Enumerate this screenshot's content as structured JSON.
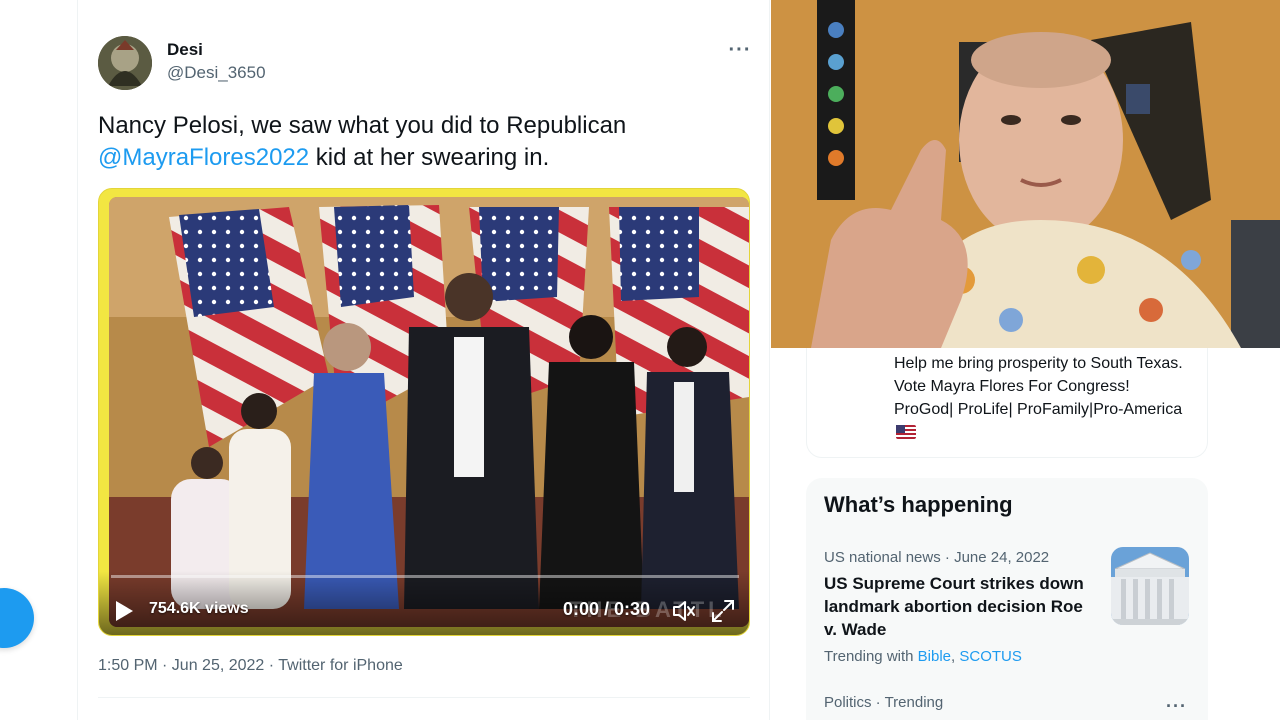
{
  "tweet": {
    "display_name": "Desi",
    "handle": "@Desi_3650",
    "text_before": "Nancy Pelosi, we saw what you did to Republican ",
    "mention": "@MayraFlores2022",
    "text_after": " kid at her swearing in.",
    "more_icon": "more-horizontal-icon",
    "meta": "1:50 PM · Jun 25, 2022 · Twitter for iPhone"
  },
  "video": {
    "views": "754.6K views",
    "time": "0:00 / 0:30",
    "watermark": "THE BATTL",
    "progress": 0,
    "icons": [
      "play-icon",
      "volume-icon",
      "fullscreen-icon"
    ]
  },
  "sidebar": {
    "bio": "Help me bring prosperity to South Texas. Vote Mayra Flores For Congress! ProGod| ProLife| ProFamily|Pro-America",
    "happening": {
      "title": "What’s happening",
      "trends": [
        {
          "meta": "US national news · June 24, 2022",
          "headline": "US Supreme Court strikes down landmark abortion decision Roe v. Wade",
          "trending_with_label": "Trending with",
          "links": [
            "Bible",
            "SCOTUS"
          ]
        },
        {
          "meta": "Politics · Trending"
        }
      ]
    }
  },
  "colors": {
    "accent": "#1d9bf0",
    "text": "#0f1419",
    "secondary": "#536471",
    "video_border": "#f2e642"
  }
}
